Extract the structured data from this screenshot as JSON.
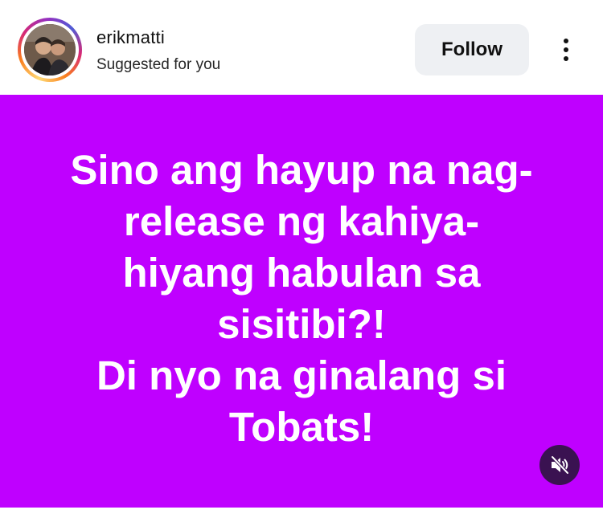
{
  "post": {
    "username": "erikmatti",
    "subtitle": "Suggested for you",
    "follow_label": "Follow",
    "more_icon": "more-vertical-icon",
    "avatar_alt": "profile photo",
    "text": "Sino ang hayup na nag-\nrelease ng kahiya-\nhiyang habulan sa\nsisitibi?!\nDi nyo na ginalang si\nTobats!",
    "background_color": "#bf00ff",
    "mute_icon": "muted-speaker-icon"
  }
}
